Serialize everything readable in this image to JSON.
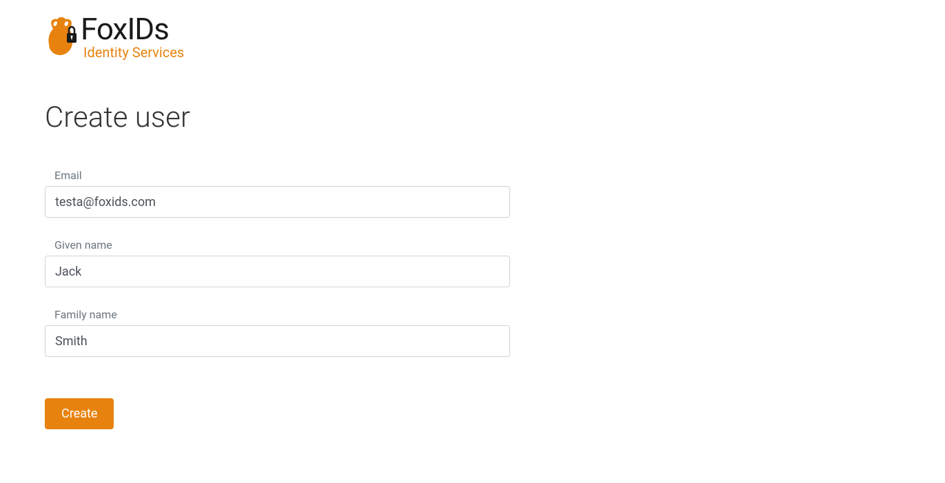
{
  "brand": {
    "title": "FoxIDs",
    "subtitle": "Identity Services"
  },
  "page": {
    "title": "Create user"
  },
  "form": {
    "email": {
      "label": "Email",
      "value": "testa@foxids.com"
    },
    "given_name": {
      "label": "Given name",
      "value": "Jack"
    },
    "family_name": {
      "label": "Family name",
      "value": "Smith"
    },
    "submit_label": "Create"
  }
}
